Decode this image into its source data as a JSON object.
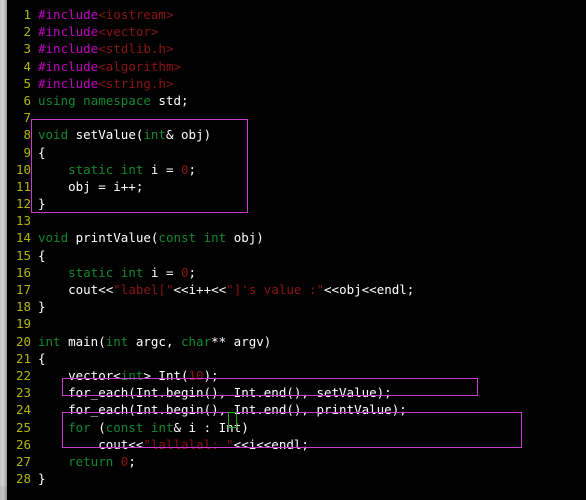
{
  "editor": {
    "language": "C++",
    "background_color": "#000000",
    "gutter_color": "#b5b500",
    "keyword_color": "#0f8a2f",
    "preprocessor_color": "#c000c0",
    "string_color": "#8b1414",
    "plain_text_color": "#ffffff",
    "highlight_box_color": "#cc39cc",
    "cursor_color": "#1faa1f",
    "first_visible_line": 1,
    "last_visible_line": 28
  },
  "scrollbar": {
    "name": "vertical-scrollbar",
    "position": "left"
  },
  "lines": [
    {
      "n": "1",
      "tokens": [
        {
          "t": "#include",
          "c": "pre"
        },
        {
          "t": "<iostream>",
          "c": "hdr"
        }
      ]
    },
    {
      "n": "2",
      "tokens": [
        {
          "t": "#include",
          "c": "pre"
        },
        {
          "t": "<vector>",
          "c": "hdr"
        }
      ]
    },
    {
      "n": "3",
      "tokens": [
        {
          "t": "#include",
          "c": "pre"
        },
        {
          "t": "<stdlib.h>",
          "c": "hdr"
        }
      ]
    },
    {
      "n": "4",
      "tokens": [
        {
          "t": "#include",
          "c": "pre"
        },
        {
          "t": "<algorithm>",
          "c": "hdr"
        }
      ]
    },
    {
      "n": "5",
      "tokens": [
        {
          "t": "#include",
          "c": "pre"
        },
        {
          "t": "<string.h>",
          "c": "hdr"
        }
      ]
    },
    {
      "n": "6",
      "tokens": [
        {
          "t": "using",
          "c": "kw"
        },
        {
          "t": " ",
          "c": "pln"
        },
        {
          "t": "namespace",
          "c": "kw"
        },
        {
          "t": " std;",
          "c": "pln"
        }
      ]
    },
    {
      "n": "7",
      "tokens": []
    },
    {
      "n": "8",
      "tokens": [
        {
          "t": "void",
          "c": "kw"
        },
        {
          "t": " setValue(",
          "c": "pln"
        },
        {
          "t": "int",
          "c": "kw"
        },
        {
          "t": "& obj)",
          "c": "pln"
        }
      ]
    },
    {
      "n": "9",
      "tokens": [
        {
          "t": "{",
          "c": "pln"
        }
      ]
    },
    {
      "n": "10",
      "tokens": [
        {
          "t": "    ",
          "c": "pln"
        },
        {
          "t": "static",
          "c": "kw"
        },
        {
          "t": " ",
          "c": "pln"
        },
        {
          "t": "int",
          "c": "kw"
        },
        {
          "t": " i = ",
          "c": "pln"
        },
        {
          "t": "0",
          "c": "num"
        },
        {
          "t": ";",
          "c": "pln"
        }
      ]
    },
    {
      "n": "11",
      "tokens": [
        {
          "t": "    obj = i++;",
          "c": "pln"
        }
      ]
    },
    {
      "n": "12",
      "tokens": [
        {
          "t": "}",
          "c": "pln"
        }
      ]
    },
    {
      "n": "13",
      "tokens": []
    },
    {
      "n": "14",
      "tokens": [
        {
          "t": "void",
          "c": "kw"
        },
        {
          "t": " printValue(",
          "c": "pln"
        },
        {
          "t": "const",
          "c": "kw"
        },
        {
          "t": " ",
          "c": "pln"
        },
        {
          "t": "int",
          "c": "kw"
        },
        {
          "t": " obj)",
          "c": "pln"
        }
      ]
    },
    {
      "n": "15",
      "tokens": [
        {
          "t": "{",
          "c": "pln"
        }
      ]
    },
    {
      "n": "16",
      "tokens": [
        {
          "t": "    ",
          "c": "pln"
        },
        {
          "t": "static",
          "c": "kw"
        },
        {
          "t": " ",
          "c": "pln"
        },
        {
          "t": "int",
          "c": "kw"
        },
        {
          "t": " i = ",
          "c": "pln"
        },
        {
          "t": "0",
          "c": "num"
        },
        {
          "t": ";",
          "c": "pln"
        }
      ]
    },
    {
      "n": "17",
      "tokens": [
        {
          "t": "    cout<<",
          "c": "pln"
        },
        {
          "t": "\"label[\"",
          "c": "str"
        },
        {
          "t": "<<i++<<",
          "c": "pln"
        },
        {
          "t": "\"]'s value :\"",
          "c": "str"
        },
        {
          "t": "<<obj<<endl;",
          "c": "pln"
        }
      ]
    },
    {
      "n": "18",
      "tokens": [
        {
          "t": "}",
          "c": "pln"
        }
      ]
    },
    {
      "n": "19",
      "tokens": []
    },
    {
      "n": "20",
      "tokens": [
        {
          "t": "int",
          "c": "kw"
        },
        {
          "t": " main(",
          "c": "pln"
        },
        {
          "t": "int",
          "c": "kw"
        },
        {
          "t": " argc, ",
          "c": "pln"
        },
        {
          "t": "char",
          "c": "kw"
        },
        {
          "t": "** argv)",
          "c": "pln"
        }
      ]
    },
    {
      "n": "21",
      "tokens": [
        {
          "t": "{",
          "c": "pln"
        }
      ]
    },
    {
      "n": "22",
      "tokens": [
        {
          "t": "    vector<",
          "c": "pln"
        },
        {
          "t": "int",
          "c": "kw"
        },
        {
          "t": "> Int(",
          "c": "pln"
        },
        {
          "t": "10",
          "c": "num"
        },
        {
          "t": ");",
          "c": "pln"
        }
      ]
    },
    {
      "n": "23",
      "tokens": [
        {
          "t": "    for_each(Int.begin(), Int.end(), setValue);",
          "c": "pln"
        }
      ]
    },
    {
      "n": "24",
      "tokens": [
        {
          "t": "    for_each(Int.begin(), Int.end(), printValue);",
          "c": "pln"
        }
      ]
    },
    {
      "n": "25",
      "tokens": [
        {
          "t": "    ",
          "c": "pln"
        },
        {
          "t": "for",
          "c": "kw"
        },
        {
          "t": " (",
          "c": "pln"
        },
        {
          "t": "const",
          "c": "kw"
        },
        {
          "t": " ",
          "c": "pln"
        },
        {
          "t": "int",
          "c": "kw"
        },
        {
          "t": "& i : Int)",
          "c": "pln"
        }
      ]
    },
    {
      "n": "26",
      "tokens": [
        {
          "t": "        cout<<",
          "c": "pln"
        },
        {
          "t": "\"lallalal: \"",
          "c": "str"
        },
        {
          "t": "<<i<<endl;",
          "c": "pln"
        }
      ]
    },
    {
      "n": "27",
      "tokens": [
        {
          "t": "    ",
          "c": "pln"
        },
        {
          "t": "return",
          "c": "kw"
        },
        {
          "t": " ",
          "c": "pln"
        },
        {
          "t": "0",
          "c": "num"
        },
        {
          "t": ";",
          "c": "pln"
        }
      ]
    },
    {
      "n": "28",
      "tokens": [
        {
          "t": "}",
          "c": "pln"
        }
      ]
    }
  ],
  "highlights": [
    {
      "name": "setvalue-function-highlight",
      "lines": "8-12"
    },
    {
      "name": "for-each-setvalue-highlight",
      "lines": "23"
    },
    {
      "name": "range-for-loop-highlight",
      "lines": "25-26"
    }
  ],
  "cursor": {
    "name": "text-cursor",
    "line": 25,
    "character": "I"
  }
}
